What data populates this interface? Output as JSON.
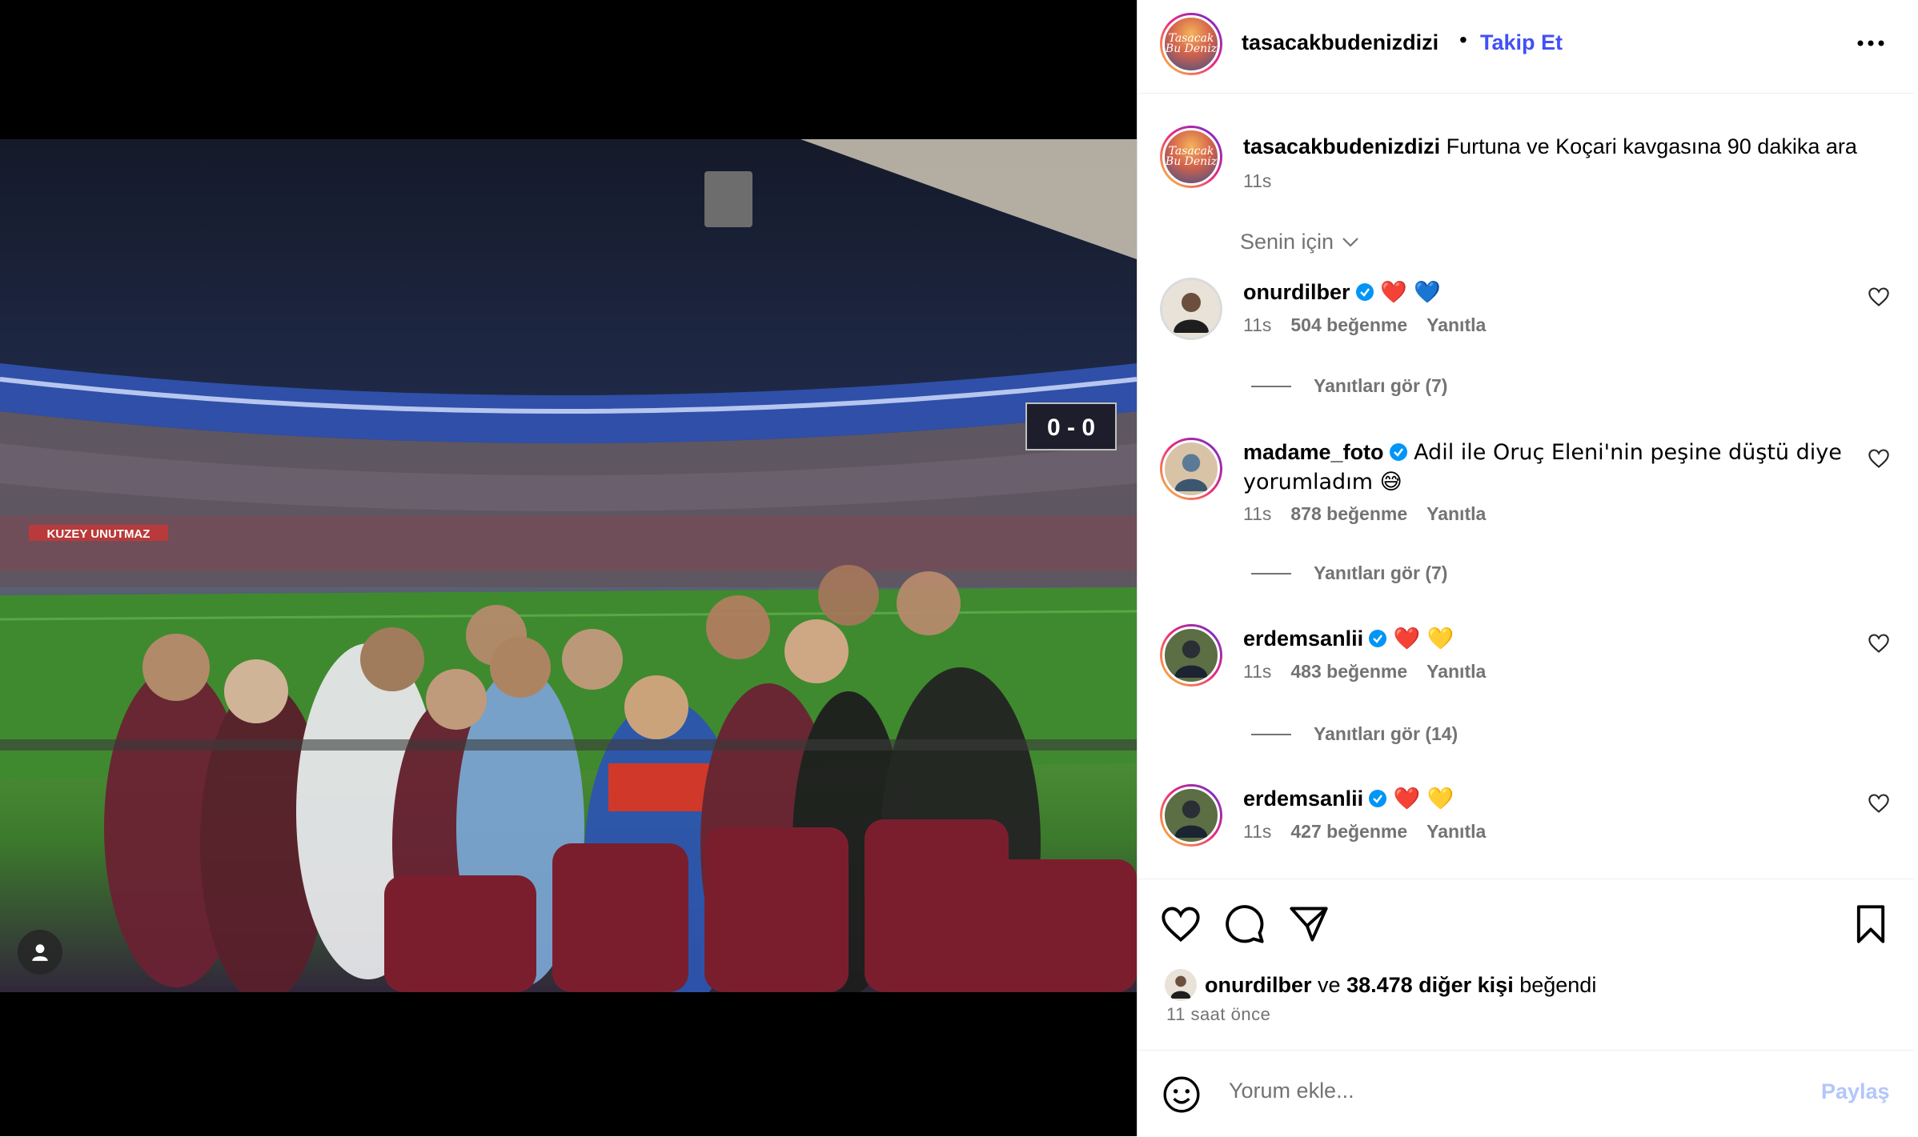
{
  "colors": {
    "accent": "#4150f7",
    "muted": "#737373",
    "verified": "#0095f6",
    "share_disabled": "#b3c6fb"
  },
  "photo": {
    "banner_text": "KUZEY UNUTMAZ",
    "scoreboard": "0 - 0"
  },
  "header": {
    "username": "tasacakbudenizdizi",
    "separator": "•",
    "follow_label": "Takip Et",
    "more_icon": "more-horizontal-icon",
    "avatar_logo": "Tasacak Bu Deniz"
  },
  "caption": {
    "username": "tasacakbudenizdizi",
    "text": "Furtuna ve Koçari kavgasına 90 dakika ara",
    "time": "11s"
  },
  "filter": {
    "label": "Senin için",
    "icon": "chevron-down-icon"
  },
  "comments": [
    {
      "username": "onurdilber",
      "verified": true,
      "text": "❤️ 💙",
      "time": "11s",
      "likes": "504 beğenme",
      "reply_label": "Yanıtla",
      "view_replies": "Yanıtları gör (7)"
    },
    {
      "username": "madame_foto",
      "verified": true,
      "text": "Adil ile Oruç Eleni'nin peşine düştü diye yorumladım 😅",
      "time": "11s",
      "likes": "878 beğenme",
      "reply_label": "Yanıtla",
      "view_replies": "Yanıtları gör (7)"
    },
    {
      "username": "erdemsanlii",
      "verified": true,
      "text": "❤️ 💛",
      "time": "11s",
      "likes": "483 beğenme",
      "reply_label": "Yanıtla",
      "view_replies": "Yanıtları gör (14)"
    },
    {
      "username": "erdemsanlii",
      "verified": true,
      "text": "❤️ 💛",
      "time": "11s",
      "likes": "427 beğenme",
      "reply_label": "Yanıtla"
    }
  ],
  "likes": {
    "liker": "onurdilber",
    "connector": "ve",
    "others": "38.478 diğer kişi",
    "suffix": "beğendi"
  },
  "timestamp": "11 saat önce",
  "comment_box": {
    "placeholder": "Yorum ekle...",
    "share_label": "Paylaş"
  }
}
